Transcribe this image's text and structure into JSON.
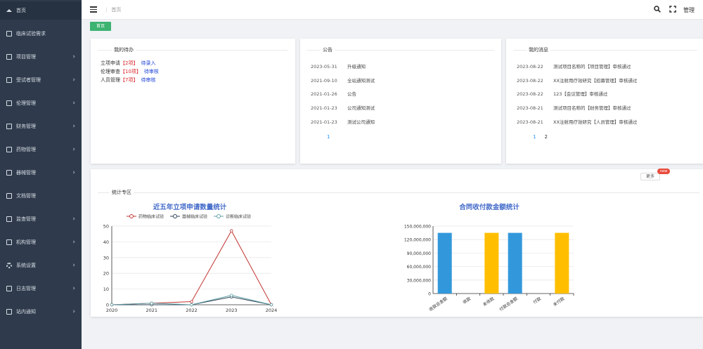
{
  "sidebar": {
    "items": [
      {
        "label": "首页",
        "icon": "home-icon",
        "chevron": false
      },
      {
        "label": "临床试验需求",
        "icon": "document-icon",
        "chevron": false
      },
      {
        "label": "项目管理",
        "icon": "folder-icon",
        "chevron": true
      },
      {
        "label": "受试者管理",
        "icon": "document-icon",
        "chevron": true
      },
      {
        "label": "伦理管理",
        "icon": "document-icon",
        "chevron": true
      },
      {
        "label": "财务管理",
        "icon": "document-icon",
        "chevron": true
      },
      {
        "label": "药物管理",
        "icon": "document-icon",
        "chevron": true
      },
      {
        "label": "器械管理",
        "icon": "document-icon",
        "chevron": true
      },
      {
        "label": "文档管理",
        "icon": "document-icon",
        "chevron": false
      },
      {
        "label": "监查管理",
        "icon": "document-icon",
        "chevron": true
      },
      {
        "label": "机构管理",
        "icon": "document-icon",
        "chevron": true
      },
      {
        "label": "系统设置",
        "icon": "gear-icon",
        "chevron": true
      },
      {
        "label": "日志管理",
        "icon": "document-icon",
        "chevron": true
      },
      {
        "label": "站内通知",
        "icon": "document-icon",
        "chevron": true
      }
    ]
  },
  "header": {
    "breadcrumb": "首页",
    "user": "管理"
  },
  "tab": {
    "home_label": "首页"
  },
  "todo": {
    "title": "我的待办",
    "rows": [
      {
        "prefix": "立项申请",
        "count": "【2项】",
        "action": "待录入"
      },
      {
        "prefix": "伦理审查",
        "count": "【10项】",
        "action": "待审核"
      },
      {
        "prefix": "人员管理",
        "count": "【7项】",
        "action": "待审核"
      }
    ]
  },
  "notice": {
    "title": "公告",
    "rows": [
      {
        "date": "2023-05-31",
        "text": "升级通知"
      },
      {
        "date": "2021-09-10",
        "text": "全站通知测试"
      },
      {
        "date": "2021-01-26",
        "text": "公告"
      },
      {
        "date": "2021-01-23",
        "text": "公司通知测试"
      },
      {
        "date": "2021-01-23",
        "text": "测试公司通知"
      }
    ],
    "pages": [
      "1"
    ]
  },
  "messages": {
    "title": "我的消息",
    "rows": [
      {
        "date": "2023-08-22",
        "text": "测试项目名称的【项目管理】审核通过"
      },
      {
        "date": "2023-08-22",
        "text": "XX注射用疗效研究【招募管理】审核通过"
      },
      {
        "date": "2023-08-22",
        "text": "123【会议管理】审核通过"
      },
      {
        "date": "2023-08-21",
        "text": "测试项目名称的【财务管理】审核通过"
      },
      {
        "date": "2023-08-21",
        "text": "XX注射用疗效研究【人员管理】审核通过"
      }
    ],
    "pages": [
      "1",
      "2"
    ]
  },
  "stats": {
    "title": "统计专区",
    "more_label": "更多",
    "badge": "new"
  },
  "chart_data": [
    {
      "type": "line",
      "title": "近五年立项申请数量统计",
      "x": [
        "2020",
        "2021",
        "2022",
        "2023",
        "2024"
      ],
      "ylim": [
        0,
        50
      ],
      "yticks": [
        "0",
        "10",
        "20",
        "30",
        "40",
        "50"
      ],
      "series": [
        {
          "name": "药物临床试验",
          "values": [
            0,
            1,
            2,
            47,
            0
          ],
          "color": "#c23531"
        },
        {
          "name": "器械临床试验",
          "values": [
            0,
            0,
            0,
            5,
            0
          ],
          "color": "#2f4554"
        },
        {
          "name": "诊断临床试验",
          "values": [
            0,
            1,
            0,
            6,
            0
          ],
          "color": "#61a0a8"
        }
      ]
    },
    {
      "type": "bar",
      "title": "合同收付款金额统计",
      "categories": [
        "收款总金额",
        "收款",
        "未收款",
        "付款总金额",
        "付款",
        "未付款"
      ],
      "values": [
        135000000,
        0,
        135000000,
        135000000,
        0,
        135000000
      ],
      "colors": [
        "#3398db",
        "#3398db",
        "#ffbf00",
        "#3398db",
        "#3398db",
        "#ffbf00"
      ],
      "ylim": [
        0,
        150000000
      ],
      "yticks": [
        "0",
        "30,000,000",
        "60,000,000",
        "90,000,000",
        "120,000,000",
        "150,000,000"
      ]
    }
  ]
}
